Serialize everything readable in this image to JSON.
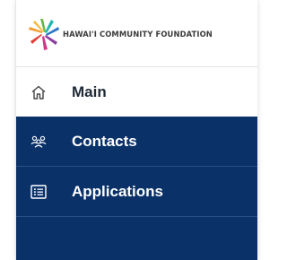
{
  "header": {
    "logo_text": "HAWAI'I COMMUNITY FOUNDATION",
    "logo_icon": "hawaii-community-foundation-logo-icon"
  },
  "nav": {
    "items": [
      {
        "label": "Main",
        "icon": "home-icon",
        "active": true
      },
      {
        "label": "Contacts",
        "icon": "users-icon"
      },
      {
        "label": "Applications",
        "icon": "list-icon"
      }
    ]
  },
  "colors": {
    "nav_background": "#0a3168",
    "nav_text": "#ffffff",
    "active_text": "#1f2a36",
    "logo_orange": "#f39c2b",
    "logo_red": "#e0403a",
    "logo_pink": "#d6358c",
    "logo_purple": "#8e3da0",
    "logo_green": "#68b84a",
    "logo_teal": "#1fb7b0",
    "logo_blue": "#2a77c7"
  }
}
